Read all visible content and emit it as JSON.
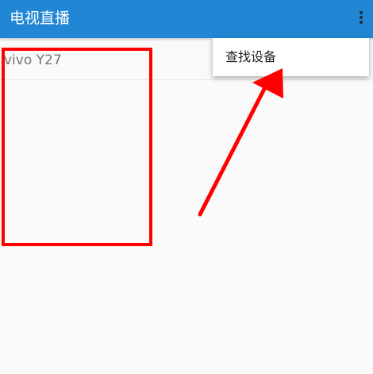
{
  "app_bar": {
    "title": "电视直播",
    "background_color": "#2186d4",
    "overflow_icon": "more-vert-icon"
  },
  "device_list": {
    "items": [
      {
        "label": "vivo Y27"
      }
    ]
  },
  "overflow_menu": {
    "items": [
      {
        "label": "查找设备"
      }
    ]
  },
  "annotation": {
    "color": "#ff0000"
  }
}
